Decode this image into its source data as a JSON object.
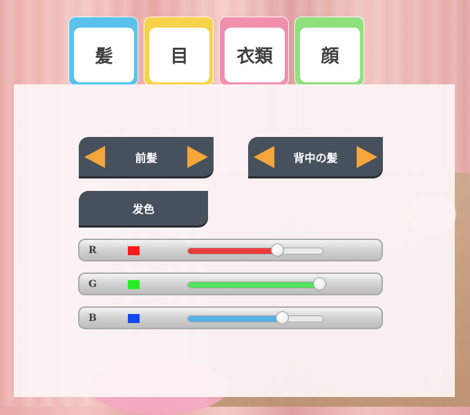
{
  "tabs": [
    {
      "label": "髪",
      "color": "#59c3ec"
    },
    {
      "label": "目",
      "color": "#f7d24b"
    },
    {
      "label": "衣類",
      "color": "#f28fae"
    },
    {
      "label": "顔",
      "color": "#8fe07c"
    }
  ],
  "front_hair": {
    "label": "前髪"
  },
  "back_hair": {
    "label": "背中の髪"
  },
  "hair_color": {
    "label": "发色"
  },
  "sliders": [
    {
      "label": "R",
      "color": "#ff1a1a",
      "fill_color": "#ec3a3a",
      "value": 0.66
    },
    {
      "label": "G",
      "color": "#22ee22",
      "fill_color": "#55e25f",
      "value": 0.97
    },
    {
      "label": "B",
      "color": "#1547f2",
      "fill_color": "#55b2ea",
      "value": 0.7
    }
  ],
  "colors": {
    "accent_arrow": "#f4a63a",
    "button_bg": "#47505d"
  }
}
